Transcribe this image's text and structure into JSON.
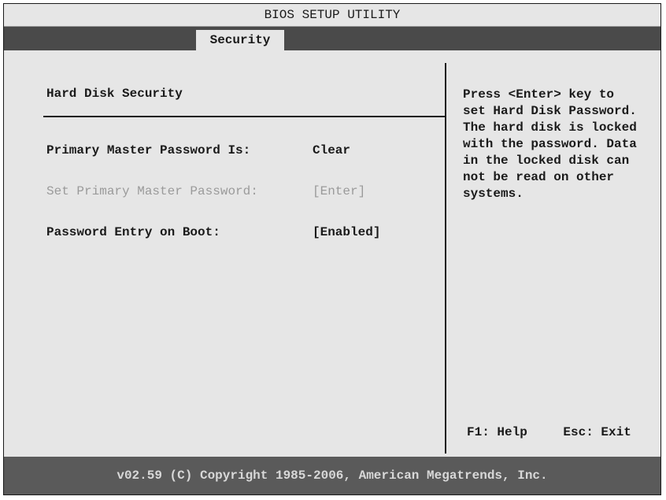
{
  "window": {
    "title": "BIOS SETUP UTILITY"
  },
  "tabs": [
    {
      "label": "Security"
    }
  ],
  "main": {
    "section_title": "Hard Disk Security",
    "rows": [
      {
        "label": "Primary Master Password Is:",
        "value": "Clear",
        "enabled": true
      },
      {
        "label": "Set Primary Master Password:",
        "value": "[Enter]",
        "enabled": false
      },
      {
        "label": "Password Entry on Boot:",
        "value": "[Enabled]",
        "enabled": true
      }
    ]
  },
  "help": {
    "text": "Press <Enter> key to\nset Hard Disk Password.\nThe hard disk is locked\nwith the password. Data\nin the locked disk can\nnot be read on other\nsystems.",
    "keys": [
      {
        "label": "F1: Help"
      },
      {
        "label": "Esc: Exit"
      }
    ]
  },
  "footer": {
    "text": "v02.59 (C) Copyright 1985-2006, American Megatrends, Inc."
  },
  "colors": {
    "background": "#e6e6e6",
    "tab_bar": "#4a4a4a",
    "footer": "#5a5a5a",
    "disabled_text": "#9a9a9a"
  }
}
